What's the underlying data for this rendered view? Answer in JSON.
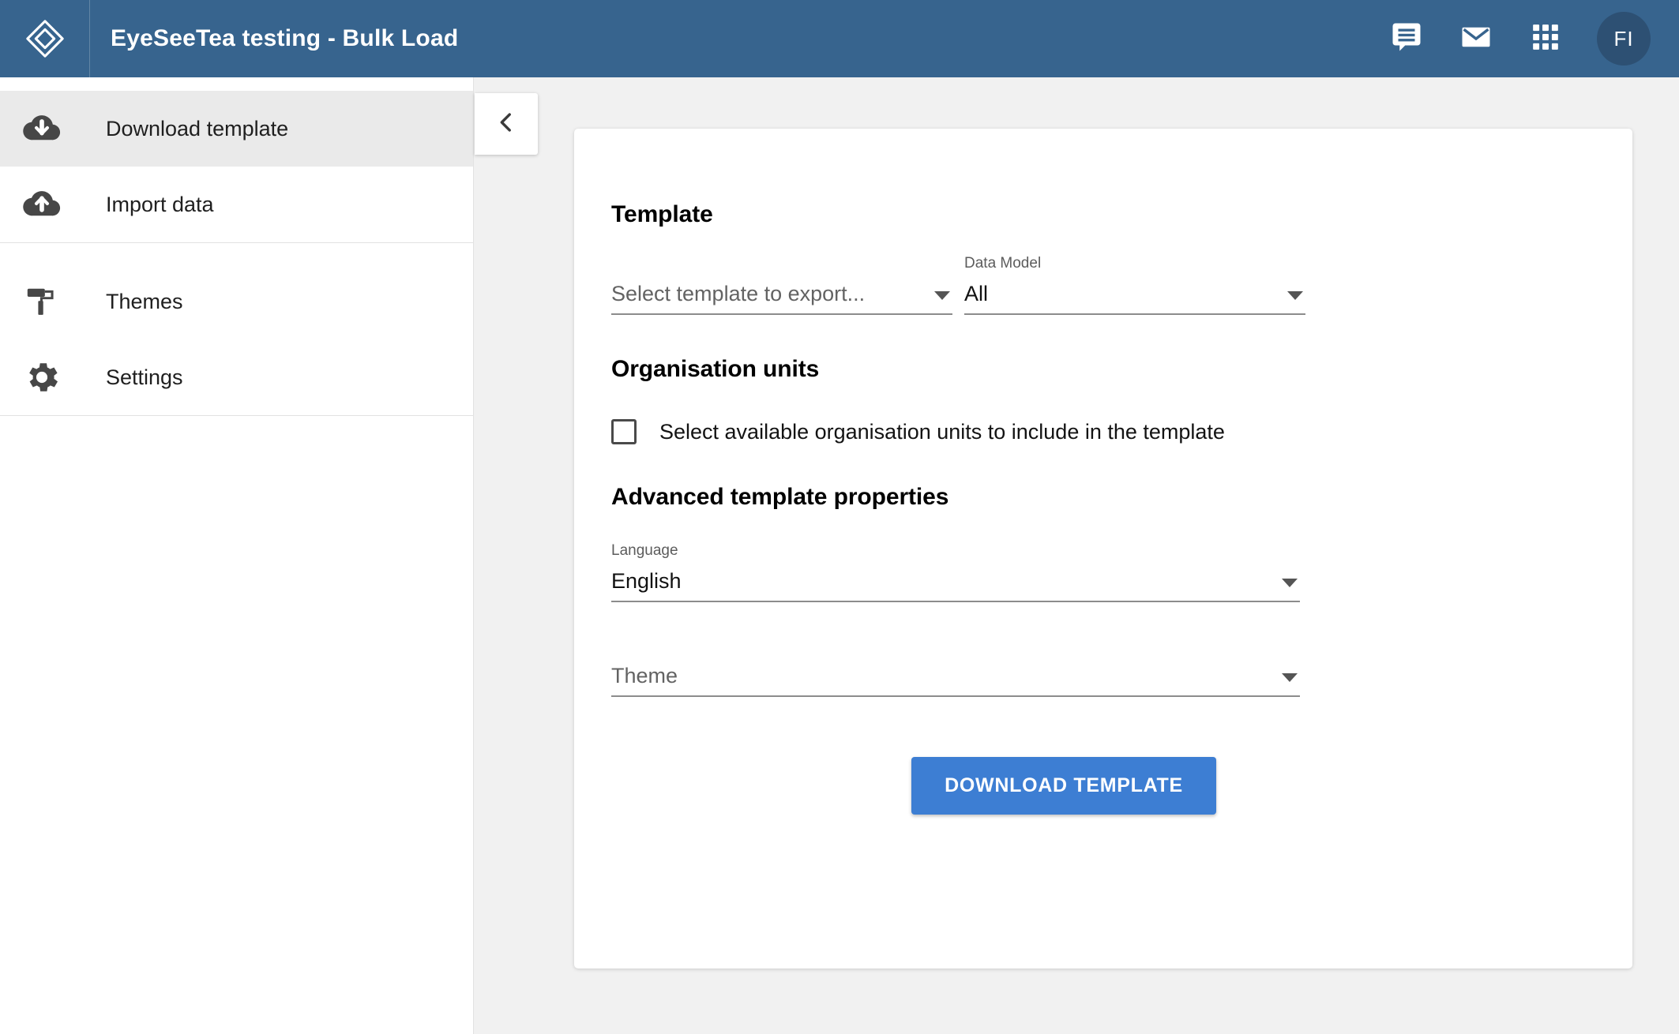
{
  "header": {
    "title": "EyeSeeTea testing - Bulk Load",
    "logo_icon": "dhis2-layers-logo-icon",
    "actions": [
      {
        "icon": "message-bubble-icon",
        "name": "messages-button"
      },
      {
        "icon": "envelope-icon",
        "name": "mail-button"
      },
      {
        "icon": "apps-grid-icon",
        "name": "apps-button"
      }
    ],
    "avatar_initials": "FI",
    "background_color": "#37648e",
    "avatar_color": "#2d5073"
  },
  "sidebar": {
    "items": [
      {
        "label": "Download template",
        "icon": "cloud-download-icon",
        "selected": true
      },
      {
        "label": "Import data",
        "icon": "cloud-upload-icon",
        "selected": false
      },
      {
        "label": "Themes",
        "icon": "paint-roller-icon",
        "selected": false
      },
      {
        "label": "Settings",
        "icon": "gear-icon",
        "selected": false
      }
    ],
    "selected_background": "#eaeaea"
  },
  "content": {
    "collapse_icon": "chevron-left-icon",
    "sections": {
      "template": {
        "heading": "Template",
        "template_select": {
          "label": "",
          "value": "Select template to export...",
          "is_placeholder": true
        },
        "data_model_select": {
          "label": "Data Model",
          "value": "All",
          "is_placeholder": false
        }
      },
      "organisation_units": {
        "heading": "Organisation units",
        "checkbox_label": "Select available organisation units to include in the template",
        "checked": false
      },
      "advanced": {
        "heading": "Advanced template properties",
        "language_select": {
          "label": "Language",
          "value": "English",
          "is_placeholder": false
        },
        "theme_select": {
          "label": "",
          "value": "Theme",
          "is_placeholder": true
        }
      }
    },
    "download_button": {
      "label": "DOWNLOAD TEMPLATE",
      "color": "#3d7ed3"
    }
  }
}
